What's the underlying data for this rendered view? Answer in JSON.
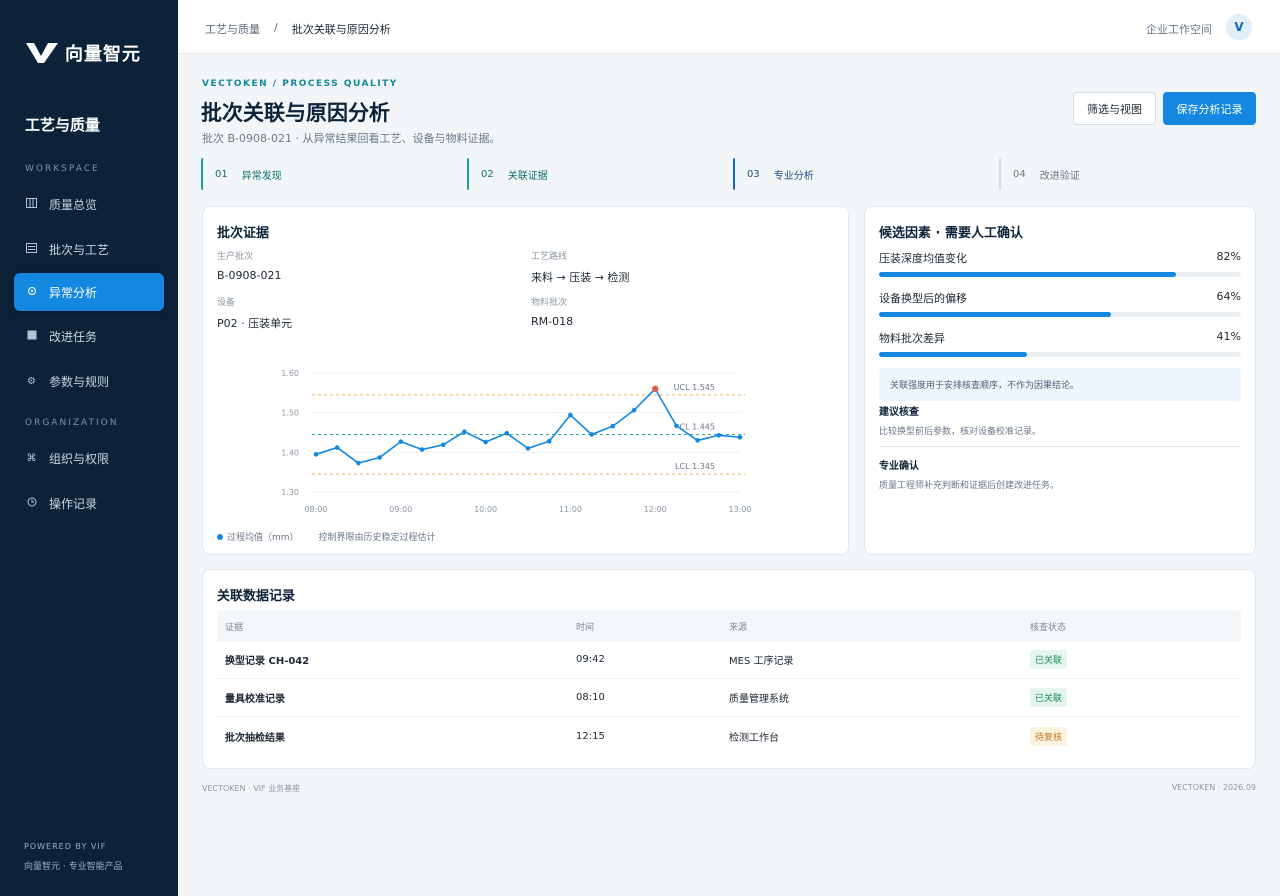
{
  "brand": {
    "name": "向量智元"
  },
  "sidebar": {
    "title": "工艺与质量",
    "section_workspace": "WORKSPACE",
    "section_org": "ORGANIZATION",
    "items": [
      {
        "label": "质量总览",
        "icon": "columns-icon"
      },
      {
        "label": "批次与工艺",
        "icon": "list-icon"
      },
      {
        "label": "异常分析",
        "icon": "target-icon"
      },
      {
        "label": "改进任务",
        "icon": "square-icon"
      },
      {
        "label": "参数与规则",
        "icon": "gear-icon"
      },
      {
        "label": "组织与权限",
        "icon": "command-icon"
      },
      {
        "label": "操作记录",
        "icon": "clock-icon"
      }
    ],
    "active_item": "异常分析",
    "footer_line1": "POWERED BY VIF",
    "footer_line2": "向量智元 · 专业智能产品"
  },
  "topbar": {
    "breadcrumb": [
      "工艺与质量",
      "/",
      "批次关联与原因分析"
    ],
    "workspace": "企业工作空间",
    "avatar": "V"
  },
  "header": {
    "kicker": "VECTOKEN / PROCESS QUALITY",
    "title": "批次关联与原因分析",
    "subtitle": "批次 B-0908-021 · 从异常结果回看工艺、设备与物料证据。",
    "filter_button": "筛选与视图",
    "save_button": "保存分析记录"
  },
  "steps": [
    {
      "num": "01",
      "label": "异常发现"
    },
    {
      "num": "02",
      "label": "关联证据"
    },
    {
      "num": "03",
      "label": "专业分析"
    },
    {
      "num": "04",
      "label": "改进验证"
    }
  ],
  "evidence": {
    "title": "批次证据",
    "fields": [
      {
        "label": "生产批次",
        "value": "B-0908-021"
      },
      {
        "label": "工艺路线",
        "value": "来料 → 压装 → 检测"
      },
      {
        "label": "设备",
        "value": "P02 · 压装单元"
      },
      {
        "label": "物料批次",
        "value": "RM-018"
      }
    ],
    "legend_series": "过程均值（mm）",
    "legend_note": "控制界限由历史稳定过程估计"
  },
  "chart_data": {
    "type": "line",
    "title": "",
    "xlabel": "",
    "ylabel": "",
    "x_ticks": [
      "08:00",
      "09:00",
      "10:00",
      "11:00",
      "12:00",
      "13:00"
    ],
    "y_ticks": [
      "1.60",
      "1.50",
      "1.40",
      "1.30"
    ],
    "xlim": [
      0,
      5
    ],
    "ylim": [
      1.3,
      1.6
    ],
    "series": [
      {
        "name": "过程均值（mm）",
        "color": "#1488e0",
        "x": [
          0,
          0.25,
          0.5,
          0.75,
          1,
          1.25,
          1.5,
          1.75,
          2,
          2.25,
          2.5,
          2.75,
          3,
          3.25,
          3.5,
          3.75,
          4,
          4.25,
          4.5,
          4.75,
          5
        ],
        "y": [
          1.395,
          1.412,
          1.373,
          1.387,
          1.427,
          1.407,
          1.419,
          1.452,
          1.426,
          1.448,
          1.41,
          1.428,
          1.494,
          1.445,
          1.466,
          1.506,
          1.56,
          1.467,
          1.43,
          1.443,
          1.438
        ]
      }
    ],
    "highlight": {
      "index": 16,
      "color": "#e05a4a"
    },
    "limits": [
      {
        "label": "UCL 1.545",
        "value": 1.545,
        "color": "#f0b060"
      },
      {
        "label": "CL 1.445",
        "value": 1.445,
        "color": "#2bb0a8"
      },
      {
        "label": "LCL 1.345",
        "value": 1.345,
        "color": "#f0b060"
      }
    ]
  },
  "factors": {
    "title": "候选因素 · 需要人工确认",
    "items": [
      {
        "label": "压装深度均值变化",
        "pct": "82%",
        "value": 0.82
      },
      {
        "label": "设备换型后的偏移",
        "pct": "64%",
        "value": 0.64
      },
      {
        "label": "物料批次差异",
        "pct": "41%",
        "value": 0.41
      }
    ],
    "note": "关联强度用于安排核查顺序，不作为因果结论。",
    "suggest_title": "建议核查",
    "suggest_text": "比较换型前后参数，核对设备校准记录。",
    "confirm_title": "专业确认",
    "confirm_text": "质量工程师补充判断和证据后创建改进任务。"
  },
  "records": {
    "title": "关联数据记录",
    "columns": [
      "证据",
      "时间",
      "来源",
      "核查状态"
    ],
    "rows": [
      {
        "evidence": "换型记录 CH-042",
        "time": "09:42",
        "source": "MES 工序记录",
        "status": "已关联",
        "status_type": "ok"
      },
      {
        "evidence": "量具校准记录",
        "time": "08:10",
        "source": "质量管理系统",
        "status": "已关联",
        "status_type": "ok"
      },
      {
        "evidence": "批次抽检结果",
        "time": "12:15",
        "source": "检测工作台",
        "status": "待复核",
        "status_type": "wait"
      }
    ]
  },
  "footer": {
    "left": "VECTOKEN  ·  VIF 业务基座",
    "right": "VECTOKEN  ·  2026.09"
  }
}
